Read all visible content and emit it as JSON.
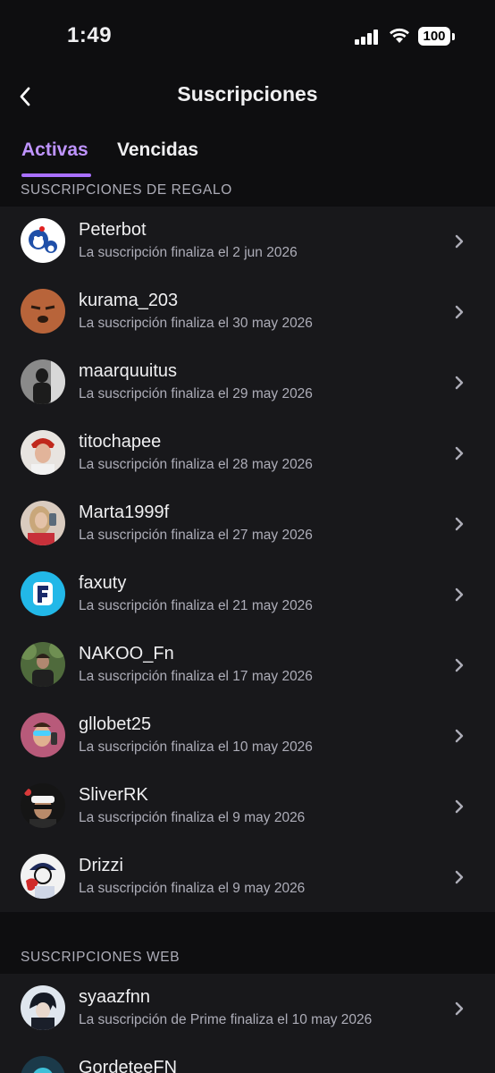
{
  "status_bar": {
    "time": "1:49",
    "battery": "100"
  },
  "header": {
    "title": "Suscripciones",
    "back_icon": "chevron-left-icon"
  },
  "tabs": [
    {
      "label": "Activas",
      "active": true
    },
    {
      "label": "Vencidas",
      "active": false
    }
  ],
  "colors": {
    "accent": "#bf94ff",
    "underline": "#a970ff",
    "background": "#0e0e10",
    "list_bg": "#18181b",
    "secondary_text": "#adadb8"
  },
  "gift_section": {
    "header": "SUSCRIPCIONES DE REGALO",
    "items": [
      {
        "name": "Peterbot",
        "subtitle": "La suscripción finaliza el 2 jun 2026"
      },
      {
        "name": "kurama_203",
        "subtitle": "La suscripción finaliza el 30 may 2026"
      },
      {
        "name": "maarquuitus",
        "subtitle": "La suscripción finaliza el 29 may 2026"
      },
      {
        "name": "titochapee",
        "subtitle": "La suscripción finaliza el 28 may 2026"
      },
      {
        "name": "Marta1999f",
        "subtitle": "La suscripción finaliza el 27 may 2026"
      },
      {
        "name": "faxuty",
        "subtitle": "La suscripción finaliza el 21 may 2026"
      },
      {
        "name": "NAKOO_Fn",
        "subtitle": "La suscripción finaliza el 17 may 2026"
      },
      {
        "name": "gllobet25",
        "subtitle": "La suscripción finaliza el 10 may 2026"
      },
      {
        "name": "SliverRK",
        "subtitle": "La suscripción finaliza el 9 may 2026"
      },
      {
        "name": "Drizzi",
        "subtitle": "La suscripción finaliza el 9 may 2026"
      }
    ]
  },
  "web_section": {
    "header": "SUSCRIPCIONES WEB",
    "items": [
      {
        "name": "syaazfnn",
        "subtitle": "La suscripción de Prime finaliza el 10 may 2026"
      },
      {
        "name": "GordeteeFN",
        "subtitle": ""
      }
    ]
  }
}
